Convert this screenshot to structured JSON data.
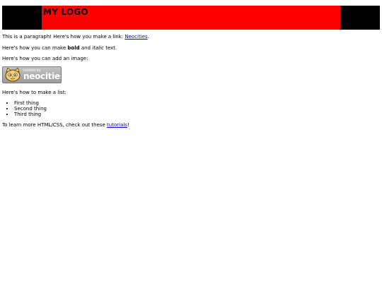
{
  "header": {
    "logo": "MY LOGO",
    "colors": {
      "bar": "#000000",
      "accent": "#ff0000"
    }
  },
  "content": {
    "p1_prefix": "This is a paragraph! Here's how you make a link: ",
    "p1_link": "Neocities",
    "p1_suffix": ".",
    "p2_prefix": "Here's how you can make ",
    "p2_bold": "bold",
    "p2_mid": " and ",
    "p2_italic": "italic",
    "p2_suffix": " text.",
    "p3": "Here's how you can add an image:",
    "badge": {
      "small": "hosted by",
      "big": "neocities",
      "icon": "neocities-cat-icon"
    },
    "p4": "Here's how to make a list:",
    "list": [
      "First thing",
      "Second thing",
      "Third thing"
    ],
    "p5_prefix": "To learn more HTML/CSS, check out these ",
    "p5_link": "tutorials",
    "p5_suffix": "!"
  }
}
